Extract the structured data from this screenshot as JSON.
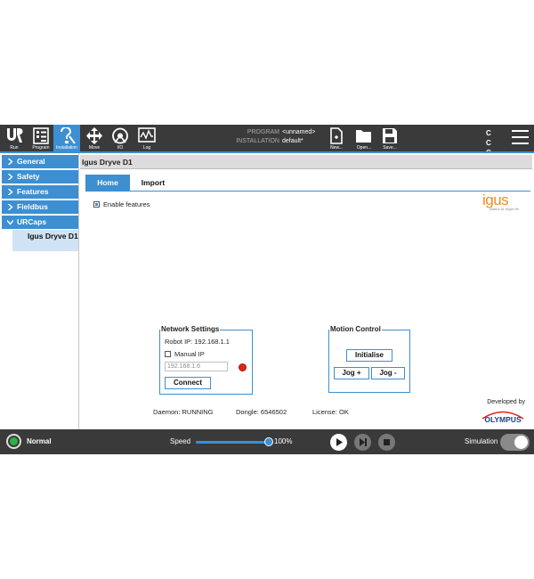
{
  "topbar": {
    "buttons": [
      {
        "label": "Run",
        "icon": "ur-logo-icon"
      },
      {
        "label": "Program",
        "icon": "program-icon"
      },
      {
        "label": "Installation",
        "icon": "installation-icon"
      },
      {
        "label": "Move",
        "icon": "move-icon"
      },
      {
        "label": "I/O",
        "icon": "io-icon"
      },
      {
        "label": "Log",
        "icon": "log-icon"
      }
    ],
    "program_key": "PROGRAM",
    "program_value": "<unnamed>",
    "installation_key": "INSTALLATION",
    "installation_value": "default*",
    "file_buttons": [
      {
        "label": "New...",
        "icon": "new-file-icon"
      },
      {
        "label": "Open...",
        "icon": "open-folder-icon"
      },
      {
        "label": "Save...",
        "icon": "save-icon"
      }
    ],
    "cc_text": "C C C C"
  },
  "sidebar": {
    "items": [
      {
        "label": "General"
      },
      {
        "label": "Safety"
      },
      {
        "label": "Features"
      },
      {
        "label": "Fieldbus"
      },
      {
        "label": "URCaps"
      }
    ],
    "sub_item": "Igus Dryve D1"
  },
  "main": {
    "header": "Igus Dryve D1",
    "tabs": [
      {
        "label": "Home"
      },
      {
        "label": "Import"
      }
    ],
    "enable_features": "Enable features",
    "logo": {
      "word": "igus",
      "tagline": "plastics for longer life"
    },
    "network": {
      "title": "Network Settings",
      "robot_ip": "Robot IP: 192.168.1.1",
      "manual_ip": "Manual IP",
      "ip_value": "192.168.1.6",
      "connect": "Connect",
      "status_color": "#e0251b"
    },
    "motion": {
      "title": "Motion Control",
      "initialise": "Initialise",
      "jog_plus": "Jog +",
      "jog_minus": "Jog -"
    },
    "status": {
      "daemon": "Daemon: RUNNING",
      "dongle": "Dongle: 6546502",
      "license": "License: OK"
    },
    "developed_by": "Developed by",
    "developer_logo": "OLYMPUS"
  },
  "bottombar": {
    "mode": "Normal",
    "speed_label": "Speed",
    "speed_value": "100%",
    "speed_fraction": 1.0,
    "simulation_label": "Simulation",
    "simulation_on": false
  },
  "colors": {
    "accent": "#3d8fd1",
    "bar": "#3a3a3a",
    "igus_orange": "#f08c1c",
    "ok_green": "#2ab344"
  }
}
